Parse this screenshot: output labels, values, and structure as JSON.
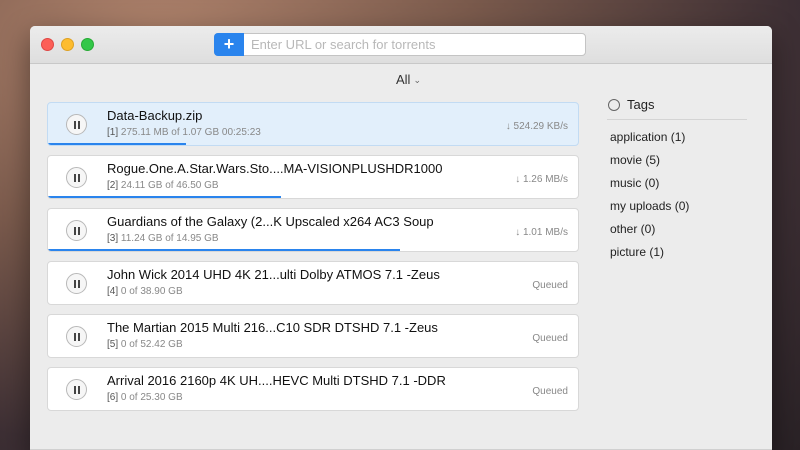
{
  "toolbar": {
    "add_label": "+",
    "search_placeholder": "Enter URL or search for torrents"
  },
  "filter": {
    "label": "All"
  },
  "torrents": [
    {
      "index": "[1]",
      "name": "Data-Backup.zip",
      "progress_text": "275.11 MB of 1.07 GB  00:25:23",
      "speed": "↓ 524.29 KB/s",
      "progress": 0.26,
      "selected": true
    },
    {
      "index": "[2]",
      "name": "Rogue.One.A.Star.Wars.Sto....MA-VISIONPLUSHDR1000",
      "progress_text": "24.11 GB of 46.50 GB",
      "speed": "↓ 1.26 MB/s",
      "progress": 0.44
    },
    {
      "index": "[3]",
      "name": "Guardians of the Galaxy (2...K Upscaled x264 AC3 Soup",
      "progress_text": "11.24 GB of 14.95 GB",
      "speed": "↓ 1.01 MB/s",
      "progress": 0.665
    },
    {
      "index": "[4]",
      "name": "John Wick 2014 UHD 4K 21...ulti Dolby ATMOS 7.1 -Zeus",
      "progress_text": "0 of 38.90 GB",
      "speed": "Queued",
      "progress": 0
    },
    {
      "index": "[5]",
      "name": "The Martian 2015 Multi 216...C10 SDR DTSHD 7.1 -Zeus",
      "progress_text": "0 of 52.42 GB",
      "speed": "Queued",
      "progress": 0
    },
    {
      "index": "[6]",
      "name": "Arrival 2016 2160p 4K UH....HEVC Multi DTSHD 7.1 -DDR",
      "progress_text": "0 of 25.30 GB",
      "speed": "Queued",
      "progress": 0
    }
  ],
  "tags": {
    "title": "Tags",
    "items": [
      "application (1)",
      "movie (5)",
      "music (0)",
      "my uploads (0)",
      "other (0)",
      "picture (1)"
    ]
  },
  "colors": {
    "accent": "#2a84ed",
    "selected_row": "#e2effb"
  }
}
